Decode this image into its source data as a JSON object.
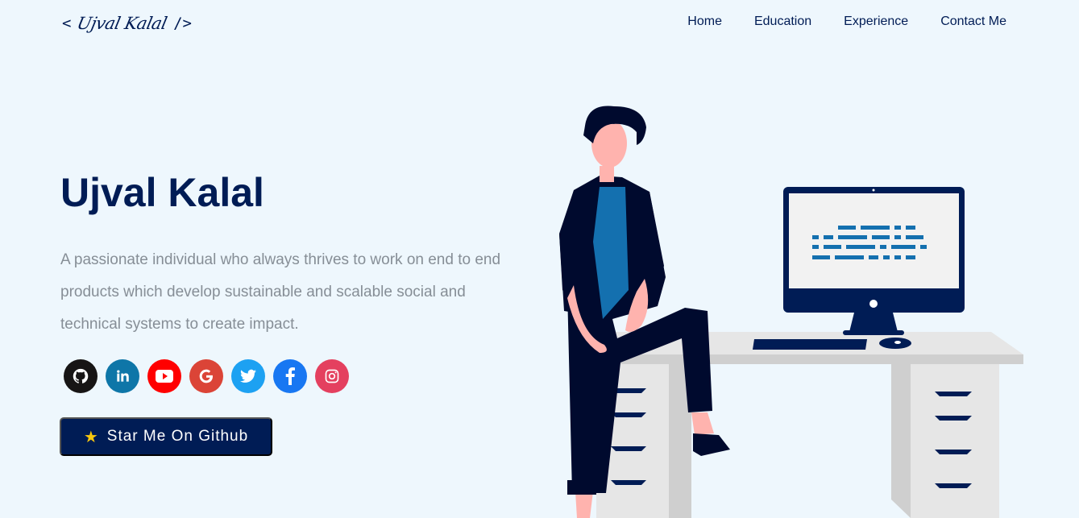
{
  "nav": {
    "logo_open": "<",
    "logo_name": "Ujval Kalal",
    "logo_close": "/>",
    "links": [
      "Home",
      "Education",
      "Experience",
      "Contact Me"
    ]
  },
  "hero": {
    "name": "Ujval Kalal",
    "bio": "A passionate individual who always thrives to work on end to end products which develop sustainable and scalable social and technical systems to create impact."
  },
  "social": [
    {
      "name": "github-icon",
      "color": "#171515",
      "glyph": "⚲"
    },
    {
      "name": "linkedin-icon",
      "color": "#0e76a8",
      "glyph": "in"
    },
    {
      "name": "youtube-icon",
      "color": "#ff0000",
      "glyph": "▶"
    },
    {
      "name": "google-icon",
      "color": "#db4437",
      "glyph": "G"
    },
    {
      "name": "twitter-icon",
      "color": "#1da1f2",
      "glyph": "🐦"
    },
    {
      "name": "facebook-icon",
      "color": "#1877f2",
      "glyph": "f"
    },
    {
      "name": "instagram-icon",
      "color": "#e4405f",
      "glyph": "◎"
    }
  ],
  "cta": {
    "star_icon": "star-icon",
    "label": "Star Me On Github"
  },
  "colors": {
    "background": "#eef7fd",
    "primary": "#001c55",
    "muted_text": "#868e96"
  }
}
